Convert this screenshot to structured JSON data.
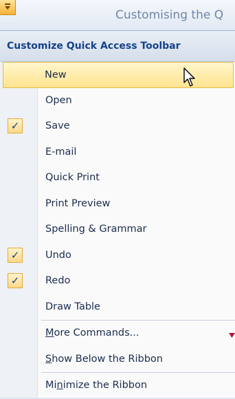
{
  "window": {
    "title": "Customising the Q"
  },
  "menu": {
    "header": "Customize Quick Access Toolbar",
    "items": [
      {
        "label": "New",
        "checked": false,
        "hover": true
      },
      {
        "label": "Open",
        "checked": false
      },
      {
        "label": "Save",
        "checked": true
      },
      {
        "label": "E-mail",
        "checked": false
      },
      {
        "label": "Quick Print",
        "checked": false
      },
      {
        "label": "Print Preview",
        "checked": false
      },
      {
        "label": "Spelling & Grammar",
        "checked": false
      },
      {
        "label": "Undo",
        "checked": true
      },
      {
        "label": "Redo",
        "checked": true
      },
      {
        "label": "Draw Table",
        "checked": false
      }
    ],
    "more_commands": {
      "pre": "",
      "key": "M",
      "post": "ore Commands..."
    },
    "show_below": {
      "pre": "",
      "key": "S",
      "post": "how Below the Ribbon"
    },
    "minimize": {
      "pre": "Mi",
      "key": "n",
      "post": "imize the Ribbon"
    },
    "check_glyph": "✓"
  },
  "colors": {
    "accent": "#15428b",
    "hover_bg": "#ffe48f",
    "check_bg": "#fbd98a"
  },
  "icons": {
    "qat": "dropdown-arrow-icon",
    "cursor": "mouse-pointer-icon"
  }
}
